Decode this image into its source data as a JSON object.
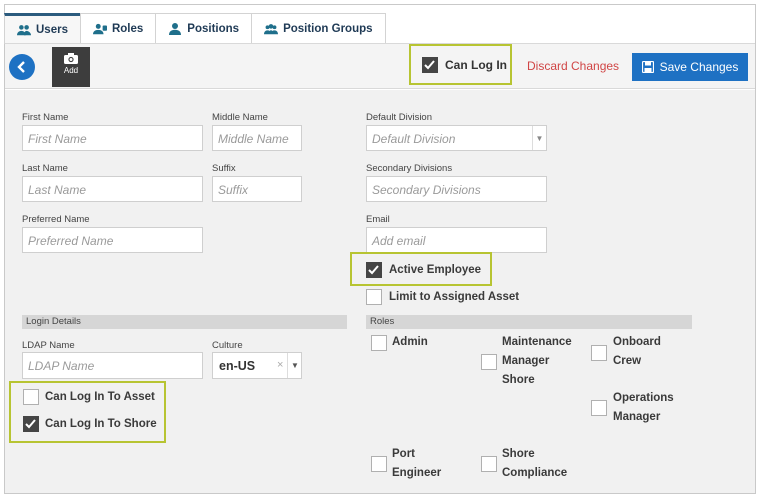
{
  "tabs": [
    {
      "label": "Users",
      "icon": "users-icon"
    },
    {
      "label": "Roles",
      "icon": "roles-icon"
    },
    {
      "label": "Positions",
      "icon": "person-icon"
    },
    {
      "label": "Position Groups",
      "icon": "groups-icon"
    }
  ],
  "toolbar": {
    "add_label": "Add",
    "can_log_in_label": "Can Log In",
    "can_log_in_checked": true,
    "discard_label": "Discard Changes",
    "save_label": "Save Changes"
  },
  "form": {
    "first_name": {
      "label": "First Name",
      "placeholder": "First Name"
    },
    "middle_name": {
      "label": "Middle Name",
      "placeholder": "Middle Name"
    },
    "last_name": {
      "label": "Last Name",
      "placeholder": "Last Name"
    },
    "suffix": {
      "label": "Suffix",
      "placeholder": "Suffix"
    },
    "preferred_name": {
      "label": "Preferred Name",
      "placeholder": "Preferred Name"
    },
    "default_division": {
      "label": "Default Division",
      "placeholder": "Default Division"
    },
    "secondary_divisions": {
      "label": "Secondary Divisions",
      "placeholder": "Secondary Divisions"
    },
    "email": {
      "label": "Email",
      "placeholder": "Add email"
    },
    "active_employee": {
      "label": "Active Employee",
      "checked": true
    },
    "limit_to_asset": {
      "label": "Limit to Assigned Asset",
      "checked": false
    }
  },
  "login_details": {
    "section_title": "Login Details",
    "ldap": {
      "label": "LDAP Name",
      "placeholder": "LDAP Name"
    },
    "culture": {
      "label": "Culture",
      "value": "en-US",
      "clear": "×",
      "arrow": "▼"
    },
    "can_log_in_to_asset": {
      "label": "Can Log In To Asset",
      "checked": false
    },
    "can_log_in_to_shore": {
      "label": "Can Log In To Shore",
      "checked": true
    }
  },
  "roles": {
    "section_title": "Roles",
    "items": [
      {
        "label_lines": [
          "Admin"
        ],
        "checked": false
      },
      {
        "label_lines": [
          "Maintenance",
          "Manager",
          "Shore"
        ],
        "checked": false
      },
      {
        "label_lines": [
          "Onboard",
          "Crew"
        ],
        "checked": false
      },
      {
        "label_lines": [
          "Operations",
          "Manager"
        ],
        "checked": false
      },
      {
        "label_lines": [
          "Port",
          "Engineer"
        ],
        "checked": false
      },
      {
        "label_lines": [
          "Shore",
          "Compliance"
        ],
        "checked": false
      }
    ]
  },
  "colors": {
    "accent": "#1e71c3",
    "highlight": "#b7c432",
    "discard": "#d04545",
    "checked": "#454545"
  }
}
